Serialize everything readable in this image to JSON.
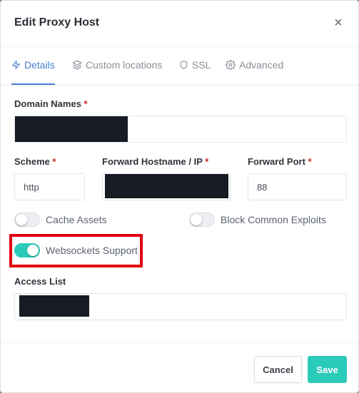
{
  "modal": {
    "title": "Edit Proxy Host",
    "close_symbol": "×"
  },
  "tabs": [
    {
      "label": "Details",
      "icon": "bolt-icon",
      "active": true
    },
    {
      "label": "Custom locations",
      "icon": "layers-icon",
      "active": false
    },
    {
      "label": "SSL",
      "icon": "shield-icon",
      "active": false
    },
    {
      "label": "Advanced",
      "icon": "gear-icon",
      "active": false
    }
  ],
  "form": {
    "domain_names": {
      "label": "Domain Names",
      "required_mark": "*",
      "value_redacted": true
    },
    "scheme": {
      "label": "Scheme",
      "required_mark": "*",
      "value": "http"
    },
    "forward_host": {
      "label": "Forward Hostname / IP",
      "required_mark": "*",
      "value_redacted": true
    },
    "forward_port": {
      "label": "Forward Port",
      "required_mark": "*",
      "value": "88"
    },
    "toggles": {
      "cache_assets": {
        "label": "Cache Assets",
        "on": false
      },
      "block_exploits": {
        "label": "Block Common Exploits",
        "on": false
      },
      "websockets": {
        "label": "Websockets Support",
        "on": true
      }
    },
    "access_list": {
      "label": "Access List",
      "value_redacted": true
    }
  },
  "footer": {
    "cancel_label": "Cancel",
    "save_label": "Save"
  },
  "colors": {
    "accent": "#467fcf",
    "toggle_on": "#2bcbba",
    "save_button": "#2bcbba",
    "required": "#cd201f",
    "highlight_box": "#e3000f"
  }
}
